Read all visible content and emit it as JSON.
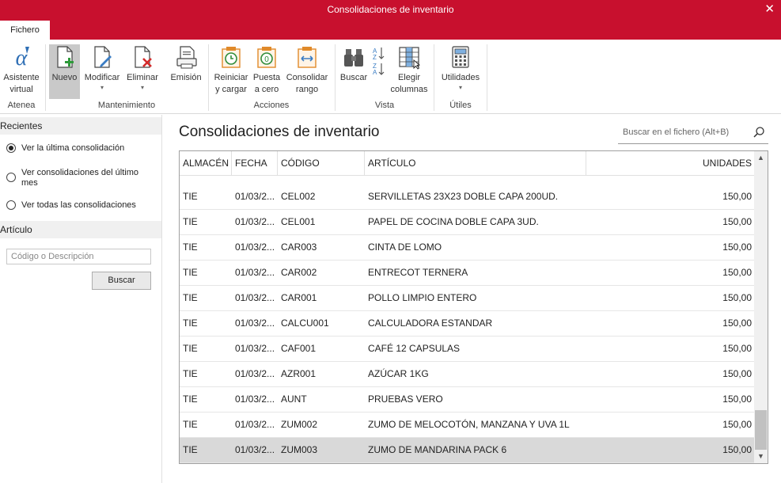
{
  "window": {
    "title": "Consolidaciones de inventario",
    "close_glyph": "✕"
  },
  "tabs": [
    {
      "label": "Fichero"
    }
  ],
  "ribbon": {
    "buttons": {
      "asistente": {
        "label1": "Asistente",
        "label2": "virtual",
        "icon": "alpha-icon"
      },
      "nuevo": {
        "label1": "Nuevo",
        "icon": "new-document-icon"
      },
      "modificar": {
        "label1": "Modificar",
        "icon": "edit-document-icon"
      },
      "eliminar": {
        "label1": "Eliminar",
        "icon": "delete-document-icon"
      },
      "emision": {
        "label1": "Emisión",
        "icon": "print-document-icon"
      },
      "reiniciar": {
        "label1": "Reiniciar",
        "label2": "y cargar",
        "icon": "reset-clock-icon"
      },
      "puesta": {
        "label1": "Puesta",
        "label2": "a cero",
        "icon": "zero-clock-icon"
      },
      "consolidar": {
        "label1": "Consolidar",
        "label2": "rango",
        "icon": "range-icon"
      },
      "buscar": {
        "label1": "Buscar",
        "icon": "binoculars-icon"
      },
      "sort": {
        "icon": "sort-az-icon"
      },
      "elegir": {
        "label1": "Elegir",
        "label2": "columnas",
        "icon": "columns-icon"
      },
      "utilidades": {
        "label1": "Utilidades",
        "icon": "calculator-icon"
      }
    },
    "groups": {
      "atenea": "Atenea",
      "mantenimiento": "Mantenimiento",
      "acciones": "Acciones",
      "vista": "Vista",
      "utiles": "Útiles"
    },
    "dropdown_glyph": "▾"
  },
  "sidebar": {
    "recientes": {
      "header": "Recientes",
      "options": [
        {
          "label": "Ver la última consolidación",
          "checked": true
        },
        {
          "label": "Ver consolidaciones del último mes",
          "checked": false
        },
        {
          "label": "Ver todas las consolidaciones",
          "checked": false
        }
      ]
    },
    "articulo": {
      "header": "Artículo",
      "placeholder": "Código o Descripción",
      "button": "Buscar"
    }
  },
  "main": {
    "title": "Consolidaciones de inventario",
    "search_placeholder": "Buscar en el fichero (Alt+B)",
    "columns": [
      "ALMACÉN",
      "FECHA",
      "CÓDIGO",
      "ARTÍCULO",
      "UNIDADES"
    ],
    "rows": [
      [
        "TIE",
        "01/03/2...",
        "CEL002",
        "SERVILLETAS 23X23 DOBLE CAPA 200UD.",
        "150,00"
      ],
      [
        "TIE",
        "01/03/2...",
        "CEL001",
        "PAPEL DE COCINA DOBLE CAPA 3UD.",
        "150,00"
      ],
      [
        "TIE",
        "01/03/2...",
        "CAR003",
        "CINTA DE LOMO",
        "150,00"
      ],
      [
        "TIE",
        "01/03/2...",
        "CAR002",
        "ENTRECOT TERNERA",
        "150,00"
      ],
      [
        "TIE",
        "01/03/2...",
        "CAR001",
        "POLLO LIMPIO ENTERO",
        "150,00"
      ],
      [
        "TIE",
        "01/03/2...",
        "CALCU001",
        "CALCULADORA ESTANDAR",
        "150,00"
      ],
      [
        "TIE",
        "01/03/2...",
        "CAF001",
        "CAFÉ 12 CAPSULAS",
        "150,00"
      ],
      [
        "TIE",
        "01/03/2...",
        "AZR001",
        "AZÚCAR 1KG",
        "150,00"
      ],
      [
        "TIE",
        "01/03/2...",
        "AUNT",
        "PRUEBAS VERO",
        "150,00"
      ],
      [
        "TIE",
        "01/03/2...",
        "ZUM002",
        "ZUMO DE MELOCOTÓN, MANZANA Y UVA 1L",
        "150,00"
      ],
      [
        "TIE",
        "01/03/2...",
        "ZUM003",
        "ZUMO DE MANDARINA PACK 6",
        "150,00"
      ]
    ],
    "selected_row": 10
  },
  "colors": {
    "brand": "#c8102e",
    "selection": "#d9d9d9"
  }
}
